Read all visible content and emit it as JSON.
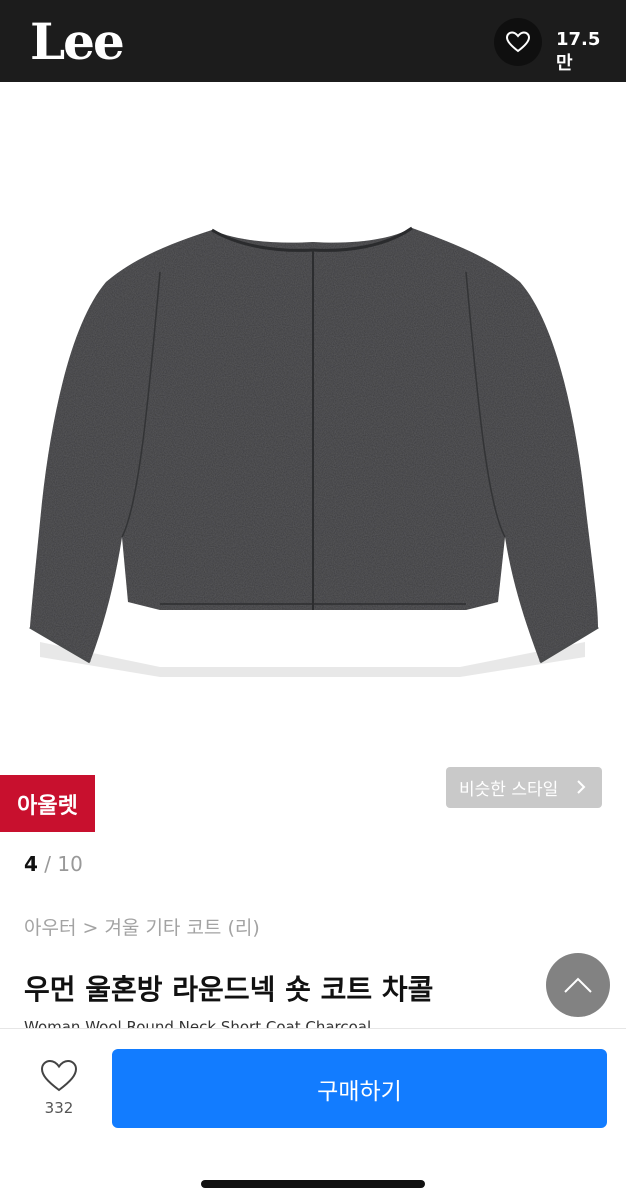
{
  "header": {
    "logo_text": "Lee",
    "wishlist_count": "17.5만",
    "background": "#1c1c1c"
  },
  "product": {
    "image_icon": "charcoal-wool-coat-image",
    "badge": "아울렛",
    "badge_color": "#c8102e",
    "similar_style_label": "비슷한 스타일",
    "pager": {
      "current": "4",
      "separator": " / ",
      "total": "10"
    },
    "breadcrumb": "아우터 > 겨울 기타 코트 (리)",
    "title": "우먼 울혼방 라운드넥 숏 코트 차콜",
    "subtitle": "Woman Wool Round Neck Short Coat Charcoal"
  },
  "bottom_bar": {
    "like_count": "332",
    "buy_label": "구매하기",
    "buy_color": "#127cff"
  }
}
